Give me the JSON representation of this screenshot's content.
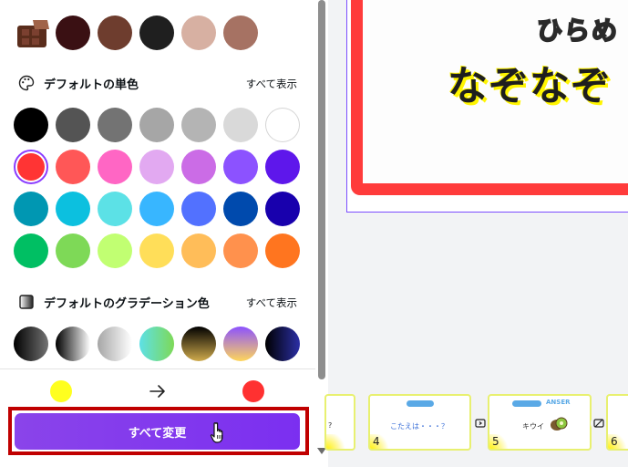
{
  "brand_colors": {
    "row": [
      "#3a1013",
      "#6e3d2e",
      "#1f1f1f",
      "#d7b0a2",
      "#a67263"
    ],
    "icon": "chocolate-icon"
  },
  "default_solid": {
    "title": "デフォルトの単色",
    "see_all": "すべて表示",
    "icon": "palette-icon",
    "selected": "#ff3434",
    "colors": [
      [
        "#000000",
        "#545454",
        "#737373",
        "#a6a6a6",
        "#b4b4b4",
        "#d9d9d9",
        "#ffffff"
      ],
      [
        "#ff3131",
        "#ff5757",
        "#ff66c4",
        "#e2a9f1",
        "#cb6ce6",
        "#8c52ff",
        "#5e17eb"
      ],
      [
        "#0097b2",
        "#0cc0df",
        "#5ce1e6",
        "#38b6ff",
        "#5271ff",
        "#004aad",
        "#1800ad"
      ],
      [
        "#00bf63",
        "#7ed957",
        "#c1ff72",
        "#ffde59",
        "#ffbd59",
        "#ff914d",
        "#ff751f"
      ]
    ]
  },
  "default_gradient": {
    "title": "デフォルトのグラデーション色",
    "see_all": "すべて表示",
    "icon": "gradient-icon",
    "gradients": [
      [
        "#000000",
        "#737373"
      ],
      [
        "#000000",
        "#ffffff"
      ],
      [
        "#a6a6a6",
        "#ffffff"
      ],
      [
        "#5de0e6",
        "#7ed957"
      ],
      [
        "#000000",
        "#cfaa4c"
      ],
      [
        "#8c52ff",
        "#ffd65a"
      ],
      [
        "#000000",
        "#2b2fa6"
      ]
    ]
  },
  "replace": {
    "from_color": "#ffff1f",
    "to_color": "#ff3131",
    "arrow_icon": "arrow-right-icon",
    "button_label": "すべて変更",
    "button_color": "#7d2ae8"
  },
  "slide": {
    "line1": "ひらめ",
    "line2": "なぞなぞ",
    "frame_color": "#ff3b3b"
  },
  "filmstrip": [
    {
      "num": "",
      "text": "?"
    },
    {
      "num": "4",
      "tag": "Q1 ★ ★ ★",
      "text": "こたえは・・・？"
    },
    {
      "num": "5",
      "tag": "Q1 ★ ★ ★",
      "tag2": "ANSER",
      "text": "キウイ"
    },
    {
      "num": "6",
      "text": ""
    }
  ]
}
